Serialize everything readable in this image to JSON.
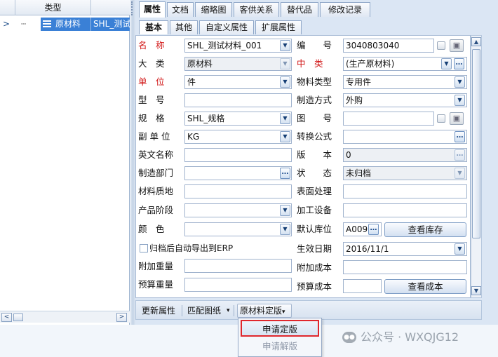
{
  "tree": {
    "header": {
      "col_type": "类型"
    },
    "row": {
      "expander": ">",
      "name": "原材料",
      "code": "SHL_测试"
    },
    "hscroll": {
      "left": "<",
      "right": ">"
    }
  },
  "tabs": [
    "属性",
    "文档",
    "缩略图",
    "客供关系",
    "替代品",
    "修改记录"
  ],
  "subtabs": [
    "基本",
    "其他",
    "自定义属性",
    "扩展属性"
  ],
  "form": {
    "name_label": "名　称",
    "name_value": "SHL_测试材料_001",
    "code_label": "编　　号",
    "code_value": "3040803040",
    "category_label": "大　类",
    "category_value": "原材料",
    "subcategory_label": "中　类",
    "subcategory_value": "(生产原材料)",
    "unit_label": "单　位",
    "unit_value": "件",
    "material_type_label": "物料类型",
    "material_type_value": "专用件",
    "model_label": "型　号",
    "model_value": "",
    "make_method_label": "制造方式",
    "make_method_value": "外购",
    "spec_label": "规　格",
    "spec_value": "SHL_规格",
    "drawing_label": "图　　号",
    "drawing_value": "",
    "sub_unit_label": "副 单 位",
    "sub_unit_value": "KG",
    "formula_label": "转换公式",
    "formula_value": "",
    "english_label": "英文名称",
    "english_value": "",
    "version_label": "版　　本",
    "version_value": "0",
    "dept_label": "制造部门",
    "dept_value": "",
    "status_label": "状　　态",
    "status_value": "未归档",
    "texture_label": "材料质地",
    "texture_value": "",
    "surface_label": "表面处理",
    "surface_value": "",
    "stage_label": "产品阶段",
    "stage_value": "",
    "equipment_label": "加工设备",
    "equipment_value": "",
    "color_label": "颜　色",
    "color_value": "",
    "warehouse_label": "默认库位",
    "warehouse_value": "A009",
    "view_stock_button": "查看库存",
    "auto_export_label": "归档后自动导出到ERP",
    "effective_date_label": "生效日期",
    "effective_date_value": "2016/11/1",
    "extra_weight_label": "附加重量",
    "extra_weight_value": "",
    "extra_cost_label": "附加成本",
    "extra_cost_value": "",
    "budget_weight_label": "预算重量",
    "budget_weight_value": "",
    "budget_cost_label": "预算成本",
    "budget_cost_value": "",
    "view_cost_button": "查看成本"
  },
  "toolbar": {
    "update_attr": "更新属性",
    "match_drawing": "匹配图纸",
    "raw_material_finalize": "原材料定版",
    "dropdown_arrow": "▾"
  },
  "menu": {
    "apply_finalize": "申请定版",
    "apply_unfinalize": "申请解版"
  },
  "watermark": {
    "text": "公众号 · WXQJG12"
  },
  "glyphs": {
    "dropdown": "▼",
    "dots": "…",
    "scroll_up": "▲",
    "scroll_down": "▼"
  },
  "colors": {
    "required_label": "#d11414",
    "selection": "#3a80d6",
    "highlight_border": "#e0272c"
  }
}
